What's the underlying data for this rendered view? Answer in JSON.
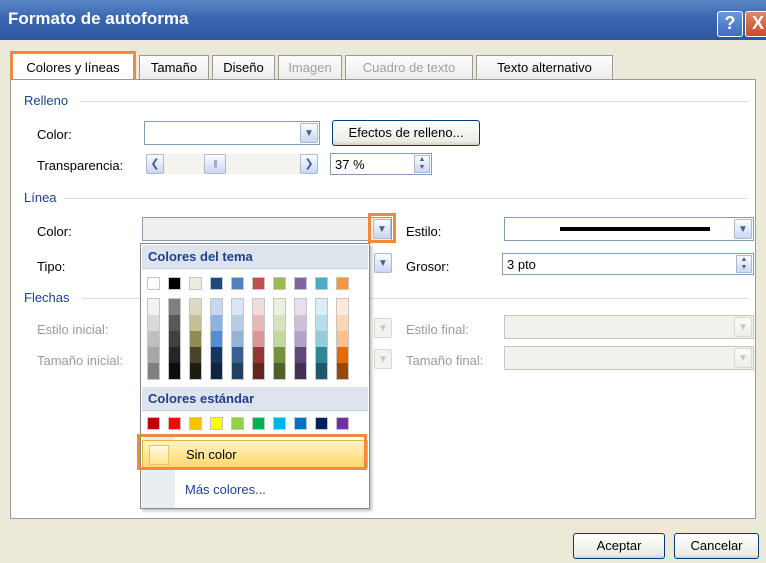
{
  "window": {
    "title": "Formato de autoforma",
    "help_glyph": "?",
    "close_glyph": "X"
  },
  "tabs": [
    {
      "label": "Colores y líneas",
      "active": true
    },
    {
      "label": "Tamaño"
    },
    {
      "label": "Diseño"
    },
    {
      "label": "Imagen",
      "disabled": true
    },
    {
      "label": "Cuadro de texto",
      "disabled": true
    },
    {
      "label": "Texto alternativo"
    }
  ],
  "relleno": {
    "group": "Relleno",
    "color_label": "Color:",
    "color_value": "",
    "effects_button": "Efectos de relleno...",
    "transparency_label": "Transparencia:",
    "transparency_value": "37 %"
  },
  "linea": {
    "group": "Línea",
    "color_label": "Color:",
    "tipo_label": "Tipo:",
    "estilo_label": "Estilo:",
    "grosor_label": "Grosor:",
    "grosor_value": "3 pto"
  },
  "flechas": {
    "group": "Flechas",
    "estilo_inicial_label": "Estilo inicial:",
    "tamano_inicial_label": "Tamaño inicial:",
    "estilo_final_label": "Estilo final:",
    "tamano_final_label": "Tamaño final:"
  },
  "color_popup": {
    "theme_header": "Colores del tema",
    "standard_header": "Colores estándar",
    "no_color": "Sin color",
    "more_colors": "Más colores...",
    "theme_colors": [
      "#ffffff",
      "#000000",
      "#eeece1",
      "#1f497d",
      "#4f81bd",
      "#c0504d",
      "#9bbb59",
      "#8064a2",
      "#4bacc6",
      "#f79646"
    ],
    "theme_shades": [
      [
        "#f2f2f2",
        "#d9d9d9",
        "#bfbfbf",
        "#a6a6a6",
        "#808080"
      ],
      [
        "#7f7f7f",
        "#595959",
        "#404040",
        "#262626",
        "#0d0d0d"
      ],
      [
        "#ddd9c3",
        "#c4bd97",
        "#948a54",
        "#4a452a",
        "#1e1c11"
      ],
      [
        "#c6d9f0",
        "#8db3e2",
        "#548dd4",
        "#17365d",
        "#0f243e"
      ],
      [
        "#dbe5f1",
        "#b8cce4",
        "#95b3d7",
        "#366092",
        "#244061"
      ],
      [
        "#f2dcdb",
        "#e5b9b7",
        "#d99694",
        "#953734",
        "#632423"
      ],
      [
        "#ebf1dd",
        "#d7e3bc",
        "#c3d69b",
        "#76923c",
        "#4f6128"
      ],
      [
        "#e5e0ec",
        "#ccc1d9",
        "#b2a2c7",
        "#5f497a",
        "#3f3151"
      ],
      [
        "#dbeef3",
        "#b7dde8",
        "#92cddc",
        "#31859b",
        "#205867"
      ],
      [
        "#fdeada",
        "#fbd5b5",
        "#fac08f",
        "#e36c09",
        "#974806"
      ]
    ],
    "standard_colors": [
      "#c00000",
      "#ff0000",
      "#ffc000",
      "#ffff00",
      "#92d050",
      "#00b050",
      "#00b0f0",
      "#0070c0",
      "#002060",
      "#7030a0"
    ]
  },
  "buttons": {
    "ok": "Aceptar",
    "cancel": "Cancelar"
  },
  "accent_color": "#f28a3c"
}
